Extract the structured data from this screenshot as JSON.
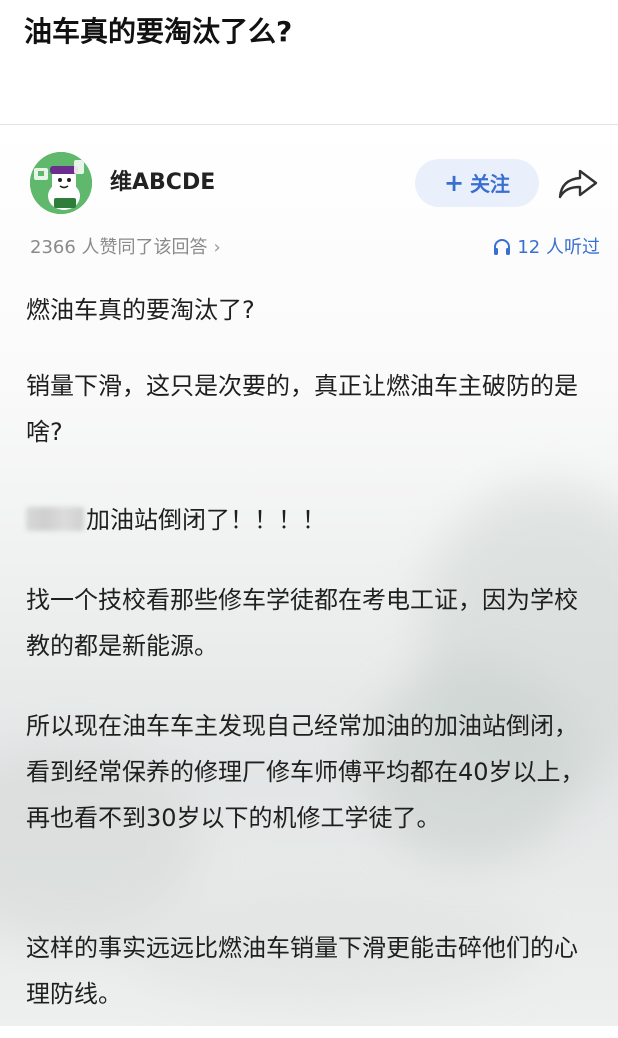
{
  "question": {
    "title": "油车真的要淘汰了么?"
  },
  "answer": {
    "author": {
      "name": "维ABCDE",
      "avatar_icon": "cartoon-avatar-icon"
    },
    "follow_button": {
      "plus": "+",
      "label": "关注"
    },
    "share_icon": "share-icon",
    "agree_text": "2366 人赞同了该回答",
    "agree_chevron": "›",
    "listen_text": "12 人听过",
    "paragraphs": {
      "p1": "燃油车真的要淘汰了?",
      "p2": "销量下滑，这只是次要的，真正让燃油车主破防的是啥?",
      "p3": "加油站倒闭了！！！！",
      "p4": "找一个技校看那些修车学徒都在考电工证，因为学校教的都是新能源。",
      "p5": "所以现在油车车主发现自己经常加油的加油站倒闭，看到经常保养的修理厂修车师傅平均都在40岁以上，再也看不到30岁以下的机修工学徒了。",
      "p6": "这样的事实远远比燃油车销量下滑更能击碎他们的心理防线。"
    },
    "colors": {
      "accent": "#3a6fd1",
      "follow_bg": "#e9f0fb",
      "avatar_bg": "#5fb86b",
      "meta_gray": "#8a8a8a"
    }
  }
}
